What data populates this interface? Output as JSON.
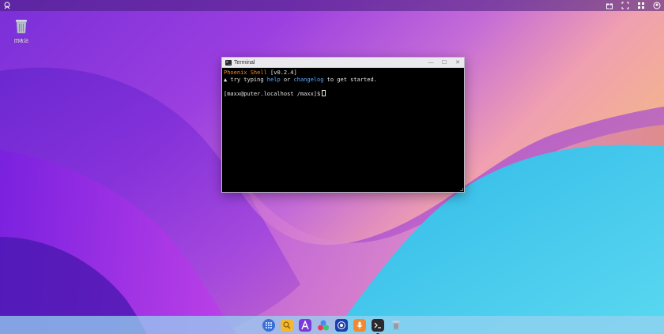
{
  "desktop": {
    "icons": [
      {
        "label": "回收站",
        "icon": "trash-icon"
      }
    ]
  },
  "window": {
    "title": "Terminal",
    "controls": [
      "minimize",
      "maximize",
      "close"
    ],
    "terminal": {
      "line1_prefix": "Phoenix Shell",
      "line1_version": " [v0.2.4]",
      "line2_a": " try typing ",
      "line2_help": "help",
      "line2_or": " or ",
      "line2_changelog": "changelog",
      "line2_b": " to get started.",
      "prompt": "[maxx@puter.localhost /maxx]$"
    }
  },
  "taskbar": {
    "apps": [
      "launcher-icon",
      "folder-icon",
      "text-editor-icon",
      "app-center-icon",
      "browser-icon",
      "microphone-icon",
      "terminal-icon",
      "trash-icon"
    ],
    "active": "terminal-icon"
  },
  "topbar": {
    "left_icon": "logo-icon",
    "right_icons": [
      "gift-icon",
      "fullscreen-icon",
      "grid-icon",
      "user-icon"
    ]
  }
}
